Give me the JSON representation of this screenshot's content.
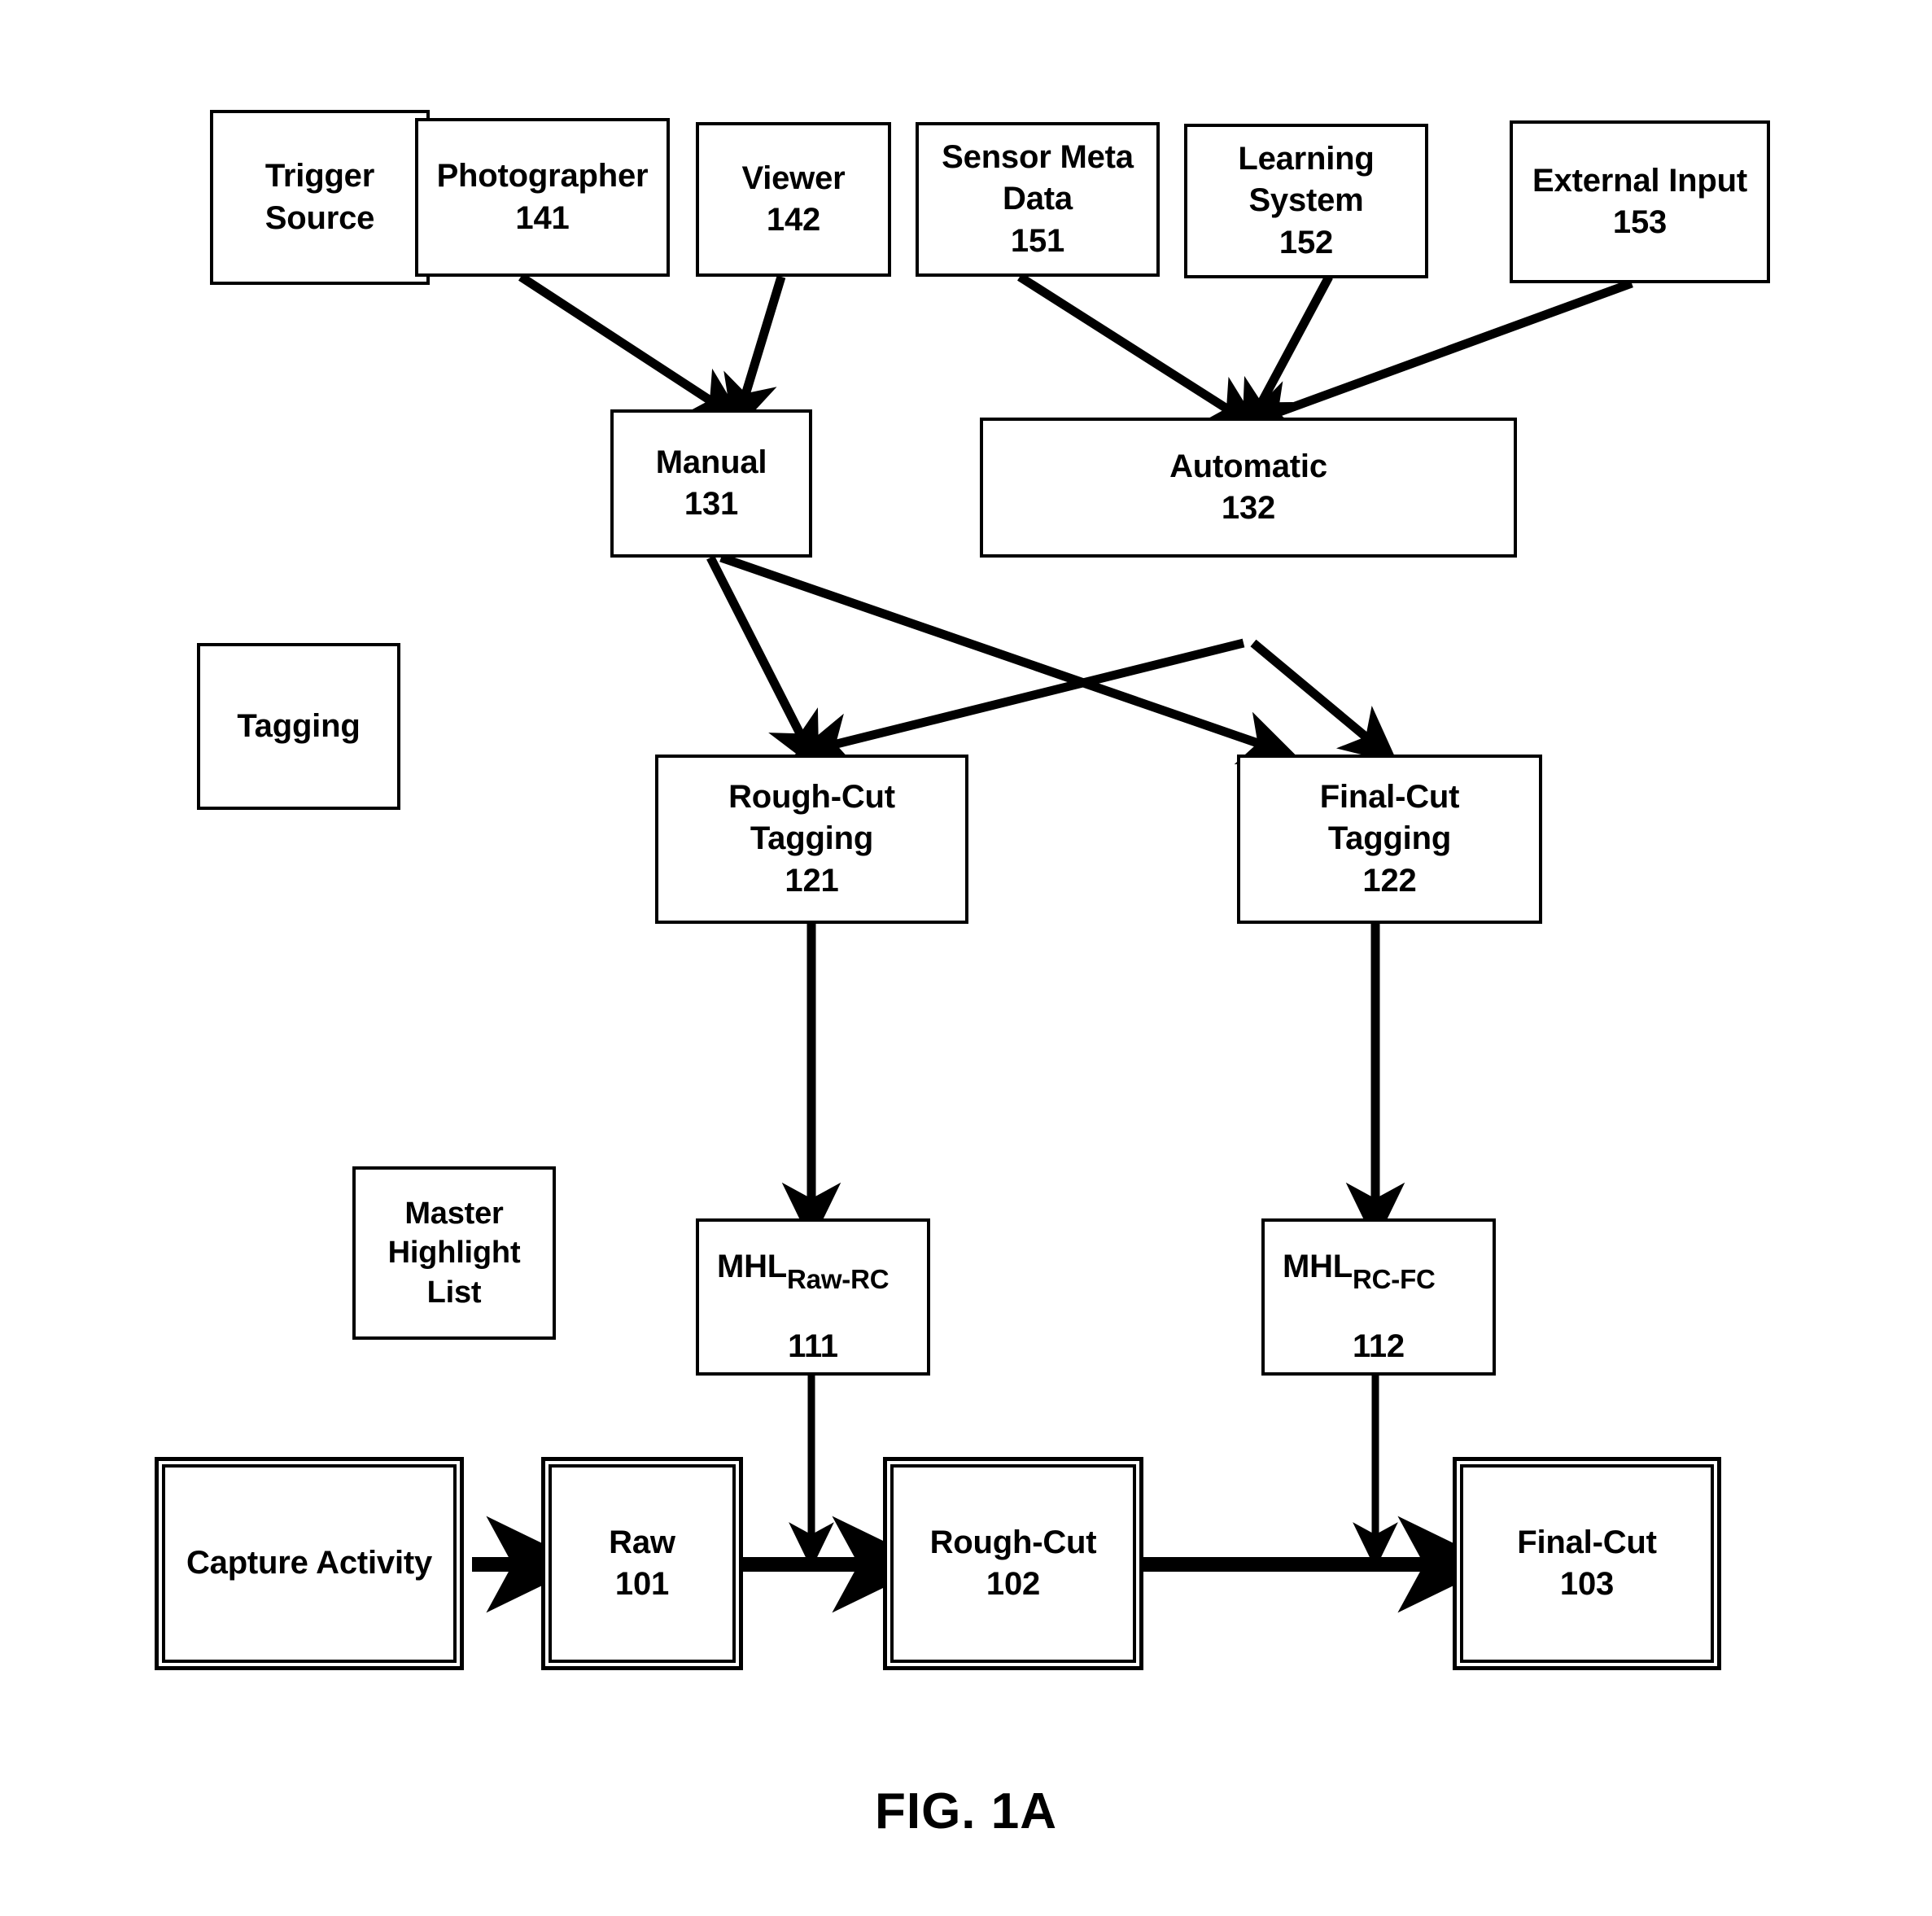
{
  "figure": {
    "caption": "FIG. 1A",
    "stroke_color": "#000000",
    "background_color": "#ffffff"
  },
  "legend_boxes": [
    {
      "id": "tagging-legend",
      "label": "Tagging"
    },
    {
      "id": "mhl-legend",
      "lines": [
        "Master",
        "Highlight",
        "List"
      ]
    }
  ],
  "nodes": {
    "trigger_source": {
      "lines": [
        "Trigger",
        "Source"
      ],
      "number": ""
    },
    "photographer": {
      "label": "Photographer",
      "number": "141"
    },
    "viewer": {
      "label": "Viewer",
      "number": "142"
    },
    "sensor_meta_data": {
      "lines": [
        "Sensor Meta",
        "Data"
      ],
      "number": "151"
    },
    "learning_system": {
      "lines": [
        "Learning",
        "System"
      ],
      "number": "152"
    },
    "external_input": {
      "label": "External Input",
      "number": "153"
    },
    "manual": {
      "label": "Manual",
      "number": "131"
    },
    "automatic": {
      "label": "Automatic",
      "number": "132"
    },
    "rough_cut_tagging": {
      "lines": [
        "Rough-Cut",
        "Tagging"
      ],
      "number": "121"
    },
    "final_cut_tagging": {
      "lines": [
        "Final-Cut",
        "Tagging"
      ],
      "number": "122"
    },
    "mhl_raw_rc": {
      "base": "MHL",
      "subscript": "Raw-RC",
      "number": "111"
    },
    "mhl_rc_fc": {
      "base": "MHL",
      "subscript": "RC-FC",
      "number": "112"
    },
    "capture_activity": {
      "label": "Capture Activity",
      "number": ""
    },
    "raw": {
      "label": "Raw",
      "number": "101"
    },
    "rough_cut": {
      "label": "Rough-Cut",
      "number": "102"
    },
    "final_cut": {
      "label": "Final-Cut",
      "number": "103"
    }
  },
  "edges": [
    {
      "from": "photographer",
      "to": "manual"
    },
    {
      "from": "viewer",
      "to": "manual"
    },
    {
      "from": "sensor_meta_data",
      "to": "automatic"
    },
    {
      "from": "learning_system",
      "to": "automatic"
    },
    {
      "from": "external_input",
      "to": "automatic"
    },
    {
      "from": "manual",
      "to": "rough_cut_tagging"
    },
    {
      "from": "manual",
      "to": "final_cut_tagging"
    },
    {
      "from": "automatic",
      "to": "rough_cut_tagging"
    },
    {
      "from": "automatic",
      "to": "final_cut_tagging"
    },
    {
      "from": "rough_cut_tagging",
      "to": "mhl_raw_rc"
    },
    {
      "from": "final_cut_tagging",
      "to": "mhl_rc_fc"
    },
    {
      "from": "mhl_raw_rc",
      "to": "rough_cut"
    },
    {
      "from": "mhl_rc_fc",
      "to": "final_cut"
    },
    {
      "from": "capture_activity",
      "to": "raw"
    },
    {
      "from": "raw",
      "to": "rough_cut"
    },
    {
      "from": "rough_cut",
      "to": "final_cut"
    }
  ]
}
